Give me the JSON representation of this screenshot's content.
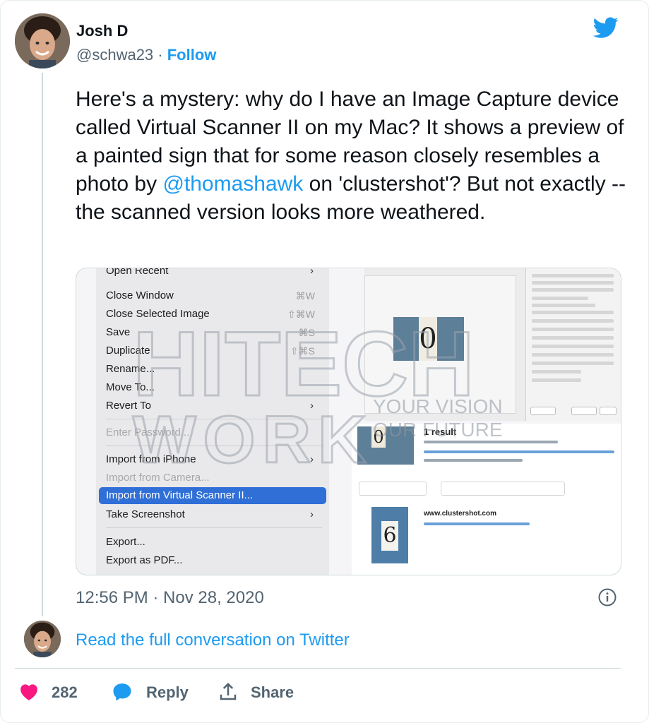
{
  "author": {
    "name": "Josh D",
    "handle": "@schwa23",
    "separator": " · ",
    "follow_label": "Follow"
  },
  "tweet": {
    "text_part1": "Here's a mystery: why do I have an Image Capture device called Virtual Scanner II on my Mac? It shows a preview of a painted sign that for some reason closely resembles a photo by ",
    "mention": "@thomashawk",
    "text_part2": " on 'clustershot'? But not exactly -- the scanned version looks more weathered."
  },
  "media": {
    "menu_items": [
      {
        "label": "Open Recent",
        "disabled": false
      },
      {
        "label": "Close Window",
        "shortcut": "⌘W"
      },
      {
        "label": "Close Selected Image",
        "shortcut": "⇧⌘W"
      },
      {
        "label": "Save",
        "shortcut": "⌘S"
      },
      {
        "label": "Duplicate",
        "shortcut": "⇧⌘S"
      },
      {
        "label": "Rename..."
      },
      {
        "label": "Move To..."
      },
      {
        "label": "Revert To"
      },
      {
        "label": "Enter Password...",
        "disabled": true
      },
      {
        "label": "Import from iPhone"
      },
      {
        "label": "Import from Camera...",
        "disabled": true
      },
      {
        "label": "Import from Virtual Scanner II..."
      },
      {
        "label": "Take Screenshot"
      },
      {
        "label": "Export..."
      },
      {
        "label": "Export as PDF..."
      }
    ],
    "scan_number": "0",
    "result_count": "1 result",
    "result_number": "6",
    "result_domain": "www.clustershot.com",
    "watermark": {
      "line1": "HITECH",
      "line2": "WORK",
      "tagline1": "YOUR VISION",
      "tagline2": "OUR FUTURE"
    }
  },
  "meta": {
    "timestamp": "12:56 PM · Nov 28, 2020",
    "read_conversation": "Read the full conversation on Twitter"
  },
  "actions": {
    "like_count": "282",
    "reply_label": "Reply",
    "share_label": "Share"
  },
  "colors": {
    "accent": "#1d9bf0",
    "like": "#f91880",
    "muted": "#536471",
    "menu_highlight": "#2f6fd6"
  },
  "icons": [
    "twitter-logo-icon",
    "info-icon",
    "heart-icon",
    "reply-bubble-icon",
    "share-icon"
  ]
}
